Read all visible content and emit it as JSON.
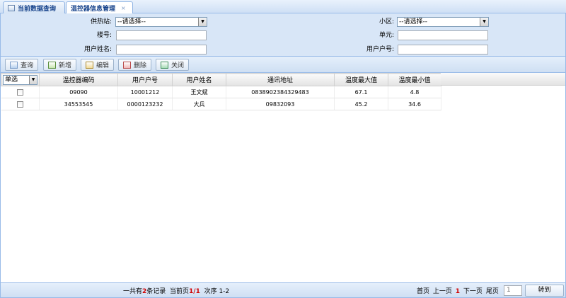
{
  "tabs": [
    {
      "label": "当前数据查询"
    },
    {
      "label": "温控器信息管理",
      "close": "×"
    }
  ],
  "search": {
    "station_label": "供热站:",
    "station_value": "--请选择--",
    "district_label": "小区:",
    "district_value": "--请选择--",
    "building_label": "楼号:",
    "unit_label": "单元:",
    "username_label": "用户姓名:",
    "account_label": "用户户号:"
  },
  "toolbar": {
    "query": "查询",
    "add": "新增",
    "edit": "编辑",
    "delete": "删除",
    "close": "关闭"
  },
  "grid": {
    "select_header": "单选",
    "columns": [
      "温控器编码",
      "用户户号",
      "用户姓名",
      "通讯地址",
      "温度最大值",
      "温度最小值"
    ],
    "rows": [
      [
        "09090",
        "10001212",
        "王文斌",
        "0838902384329483",
        "67.1",
        "4.8"
      ],
      [
        "34553545",
        "0000123232",
        "大兵",
        "09832093",
        "45.2",
        "34.6"
      ]
    ]
  },
  "footer": {
    "total_prefix": "一共有",
    "total_count": "2",
    "total_suffix": "条记录",
    "current_prefix": "当前页",
    "current_page": "1/1",
    "order_text": "次序 1-2",
    "first": "首页",
    "prev": "上一页",
    "page_num": "1",
    "next": "下一页",
    "last": "尾页",
    "page_input": "1",
    "go": "转到"
  }
}
